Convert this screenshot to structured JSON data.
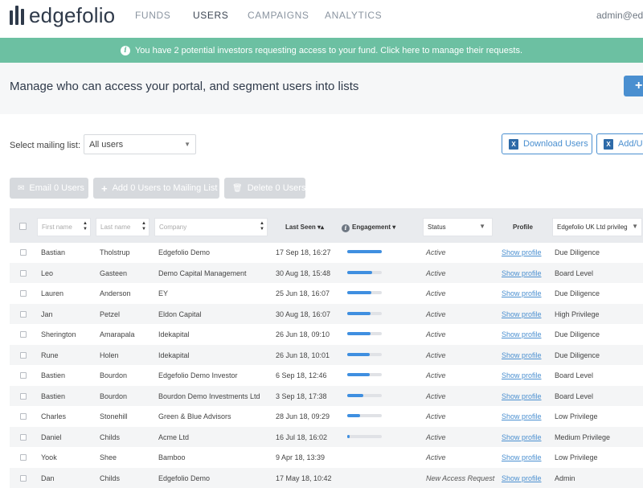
{
  "app": {
    "brand": "edgefolio",
    "nav": [
      "FUNDS",
      "USERS",
      "CAMPAIGNS",
      "ANALYTICS"
    ],
    "active_nav": "USERS",
    "user": "admin@edgefolio"
  },
  "banner": {
    "icon": "info-icon",
    "text": "You have 2 potential investors requesting access to your fund. Click here to manage their requests."
  },
  "header": {
    "title": "Manage who can access your portal, and segment users into lists",
    "add_button_icon": "+"
  },
  "controls": {
    "mailing_list_label": "Select mailing list:",
    "mailing_list_value": "All users",
    "download_label": "Download Users",
    "add_upload_label": "Add/U",
    "email_label": "Email 0 Users",
    "add_to_list_label": "Add 0 Users to Mailing List",
    "delete_label": "Delete 0 Users"
  },
  "table": {
    "filters": {
      "first_name_placeholder": "First name",
      "last_name_placeholder": "Last name",
      "company_placeholder": "Company"
    },
    "headers": {
      "last_seen": "Last Seen",
      "engagement": "Engagement",
      "status": "Status",
      "profile": "Profile",
      "privilege_select": "Edgefolio UK Ltd privileg"
    },
    "rows": [
      {
        "first": "Bastian",
        "last": "Tholstrup",
        "company": "Edgefolio Demo",
        "last_seen": "17 Sep 18, 16:27",
        "engagement": 1.0,
        "status": "Active",
        "profile": "Show profile",
        "privilege": "Due Diligence"
      },
      {
        "first": "Leo",
        "last": "Gasteen",
        "company": "Demo Capital Management",
        "last_seen": "30 Aug 18, 15:48",
        "engagement": 0.72,
        "status": "Active",
        "profile": "Show profile",
        "privilege": "Board Level"
      },
      {
        "first": "Lauren",
        "last": "Anderson",
        "company": "EY",
        "last_seen": "25 Jun 18, 16:07",
        "engagement": 0.7,
        "status": "Active",
        "profile": "Show profile",
        "privilege": "Due Diligence"
      },
      {
        "first": "Jan",
        "last": "Petzel",
        "company": "Eldon Capital",
        "last_seen": "30 Aug 18, 16:07",
        "engagement": 0.67,
        "status": "Active",
        "profile": "Show profile",
        "privilege": "High Privilege"
      },
      {
        "first": "Sherington",
        "last": "Amarapala",
        "company": "Idekapital",
        "last_seen": "26 Jun 18, 09:10",
        "engagement": 0.67,
        "status": "Active",
        "profile": "Show profile",
        "privilege": "Due Diligence"
      },
      {
        "first": "Rune",
        "last": "Holen",
        "company": "Idekapital",
        "last_seen": "26 Jun 18, 10:01",
        "engagement": 0.65,
        "status": "Active",
        "profile": "Show profile",
        "privilege": "Due Diligence"
      },
      {
        "first": "Bastien",
        "last": "Bourdon",
        "company": "Edgefolio Demo Investor",
        "last_seen": "6 Sep 18, 12:46",
        "engagement": 0.65,
        "status": "Active",
        "profile": "Show profile",
        "privilege": "Board Level"
      },
      {
        "first": "Bastien",
        "last": "Bourdon",
        "company": "Bourdon Demo Investments Ltd",
        "last_seen": "3 Sep 18, 17:38",
        "engagement": 0.47,
        "status": "Active",
        "profile": "Show profile",
        "privilege": "Board Level"
      },
      {
        "first": "Charles",
        "last": "Stonehill",
        "company": "Green & Blue Advisors",
        "last_seen": "28 Jun 18, 09:29",
        "engagement": 0.37,
        "status": "Active",
        "profile": "Show profile",
        "privilege": "Low Privilege"
      },
      {
        "first": "Daniel",
        "last": "Childs",
        "company": "Acme Ltd",
        "last_seen": "16 Jul 18, 16:02",
        "engagement": 0.07,
        "status": "Active",
        "profile": "Show profile",
        "privilege": "Medium Privilege"
      },
      {
        "first": "Yook",
        "last": "Shee",
        "company": "Bamboo",
        "last_seen": "9 Apr 18, 13:39",
        "engagement": null,
        "status": "Active",
        "profile": "Show profile",
        "privilege": "Low Privilege"
      },
      {
        "first": "Dan",
        "last": "Childs",
        "company": "Edgefolio Demo",
        "last_seen": "17 May 18, 10:42",
        "engagement": null,
        "status": "New Access Request",
        "profile": "Show profile",
        "privilege": "Admin"
      }
    ]
  }
}
